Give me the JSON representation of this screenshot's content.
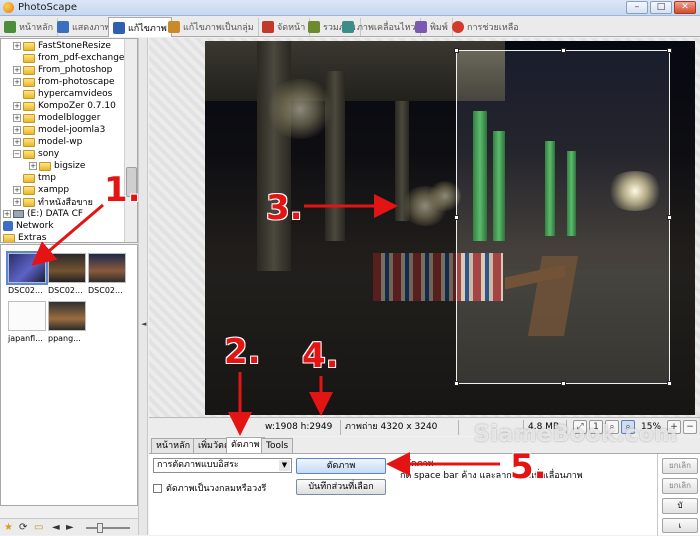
{
  "window": {
    "title": "PhotoScape"
  },
  "main_tabs": [
    {
      "label": "หน้าหลัก",
      "color": "#4b8d3a"
    },
    {
      "label": "แสดงภาพ",
      "color": "#3a6fc0"
    },
    {
      "label": "แก้ไขภาพ",
      "color": "#2f5fae"
    },
    {
      "label": "แก้ไขภาพเป็นกลุ่ม",
      "color": "#c98a2a"
    },
    {
      "label": "จัดหน้า",
      "color": "#c0392b"
    },
    {
      "label": "รวมภาพ",
      "color": "#6c8b2f"
    },
    {
      "label": "ภาพเคลื่อนไหว",
      "color": "#3c8c8c"
    },
    {
      "label": "พิมพ์",
      "color": "#7a5ab0"
    },
    {
      "label": "การช่วยเหลือ",
      "color": "#d23a2a"
    }
  ],
  "tree": {
    "items": [
      {
        "label": "FastStoneResize",
        "type": "folder",
        "expander": "+"
      },
      {
        "label": "from_pdf-exchange",
        "type": "folder",
        "expander": ""
      },
      {
        "label": "From_photoshop",
        "type": "folder",
        "expander": "+"
      },
      {
        "label": "from-photoscape",
        "type": "folder",
        "expander": "+"
      },
      {
        "label": "hypercamvideos",
        "type": "folder",
        "expander": ""
      },
      {
        "label": "KompoZer 0.7.10",
        "type": "folder",
        "expander": "+"
      },
      {
        "label": "modelblogger",
        "type": "folder",
        "expander": "+"
      },
      {
        "label": "model-joomla3",
        "type": "folder",
        "expander": "+"
      },
      {
        "label": "model-wp",
        "type": "folder",
        "expander": "+"
      },
      {
        "label": "sony",
        "type": "folder",
        "expander": "−"
      },
      {
        "label": "bigsize",
        "type": "folder",
        "expander": "+"
      },
      {
        "label": "tmp",
        "type": "folder",
        "expander": ""
      },
      {
        "label": "xampp",
        "type": "folder",
        "expander": "+"
      },
      {
        "label": "ทำหนังสือขาย",
        "type": "folder",
        "expander": "+"
      },
      {
        "label": "(E:) DATA CF",
        "type": "drive",
        "expander": "+"
      },
      {
        "label": "Network",
        "type": "network",
        "expander": ""
      },
      {
        "label": "Extras",
        "type": "folder",
        "expander": ""
      }
    ]
  },
  "thumbnails": [
    {
      "label": "DSC02...",
      "selected": true
    },
    {
      "label": "DSC02...",
      "selected": false
    },
    {
      "label": "DSC02...",
      "selected": false
    },
    {
      "label": "japanfl...",
      "selected": false
    },
    {
      "label": "ppang...",
      "selected": false
    }
  ],
  "status": {
    "dimensions": "w:1908 h:2949",
    "photo_size": "ภาพถ่าย 4320 x 3240",
    "file_size": "4.8 MB",
    "zoom": "15%"
  },
  "edit_tabs": [
    "หน้าหลัก",
    "เพิ่มวัตถุ",
    "ตัดภาพ",
    "Tools"
  ],
  "crop_panel": {
    "mode_select": "การตัดภาพแบบอิสระ",
    "round_checkbox": "ตัดภาพเป็นวงกลมหรือวงรี",
    "crop_button": "ตัดภาพ",
    "save_selection_button": "บันทึกส่วนที่เลือก",
    "hint_line1": "กด space bar ค้าง และลากเมาส์เพื่อเลื่อนภาพ",
    "hint_top": "ตัดภาพ"
  },
  "side_buttons": [
    "ยกเลิก",
    "ยกเลิก"
  ],
  "annotations": {
    "step1": "1.",
    "step2": "2.",
    "step3": "3.",
    "step4": "4.",
    "step5": "5.",
    "watermark": "SiameBook.com",
    "color": "#e41414"
  }
}
